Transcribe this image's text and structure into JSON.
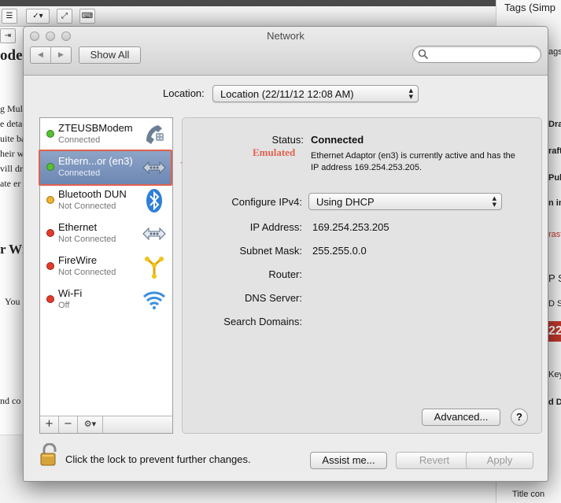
{
  "background": {
    "left_fragments": [
      "g Mul",
      "e deta",
      "uite ba",
      "heir w",
      "vill dr",
      "ate er"
    ],
    "left_heading_1": "ode",
    "left_heading_2": "r Wi",
    "left_fragment_you": "You",
    "left_fragment_bottom": "nd co",
    "right_panel": [
      "Tags (Simp",
      "ags",
      "Draf",
      "raft",
      "Pub",
      "n im",
      "rast",
      "P SI",
      "D Se",
      "22",
      "Key",
      "d D",
      "Title con"
    ]
  },
  "window": {
    "title": "Network",
    "show_all": "Show All",
    "search_placeholder": ""
  },
  "location": {
    "label": "Location:",
    "value": "Location (22/11/12 12:08 AM)"
  },
  "services": [
    {
      "name": "ZTEUSBModem",
      "status": "Connected",
      "dot_color": "#55c232",
      "icon": "modem-phone-icon"
    },
    {
      "name": "Ethern...or (en3)",
      "status": "Connected",
      "dot_color": "#55c232",
      "icon": "ethernet-icon",
      "selected": true
    },
    {
      "name": "Bluetooth DUN",
      "status": "Not Connected",
      "dot_color": "#f3b12c",
      "icon": "bluetooth-icon"
    },
    {
      "name": "Ethernet",
      "status": "Not Connected",
      "dot_color": "#e53a2a",
      "icon": "ethernet-icon"
    },
    {
      "name": "FireWire",
      "status": "Not Connected",
      "dot_color": "#e53a2a",
      "icon": "firewire-icon"
    },
    {
      "name": "Wi-Fi",
      "status": "Off",
      "dot_color": "#e53a2a",
      "icon": "wifi-icon"
    }
  ],
  "sidebar_footer": {
    "add": "+",
    "remove": "−",
    "gear": "⚙▾"
  },
  "annotation": {
    "label": "Emulated",
    "color": "#e0624f"
  },
  "detail": {
    "status_label": "Status:",
    "status_value": "Connected",
    "status_description": "Ethernet Adaptor (en3) is currently active and has the IP address 169.254.253.205.",
    "configure_label": "Configure IPv4:",
    "configure_value": "Using DHCP",
    "ip_label": "IP Address:",
    "ip_value": "169.254.253.205",
    "subnet_label": "Subnet Mask:",
    "subnet_value": "255.255.0.0",
    "router_label": "Router:",
    "dns_label": "DNS Server:",
    "search_domains_label": "Search Domains:",
    "advanced_label": "Advanced...",
    "help_label": "?"
  },
  "footer": {
    "lock_text": "Click the lock to prevent further changes.",
    "assist_label": "Assist me...",
    "revert_label": "Revert",
    "apply_label": "Apply"
  }
}
